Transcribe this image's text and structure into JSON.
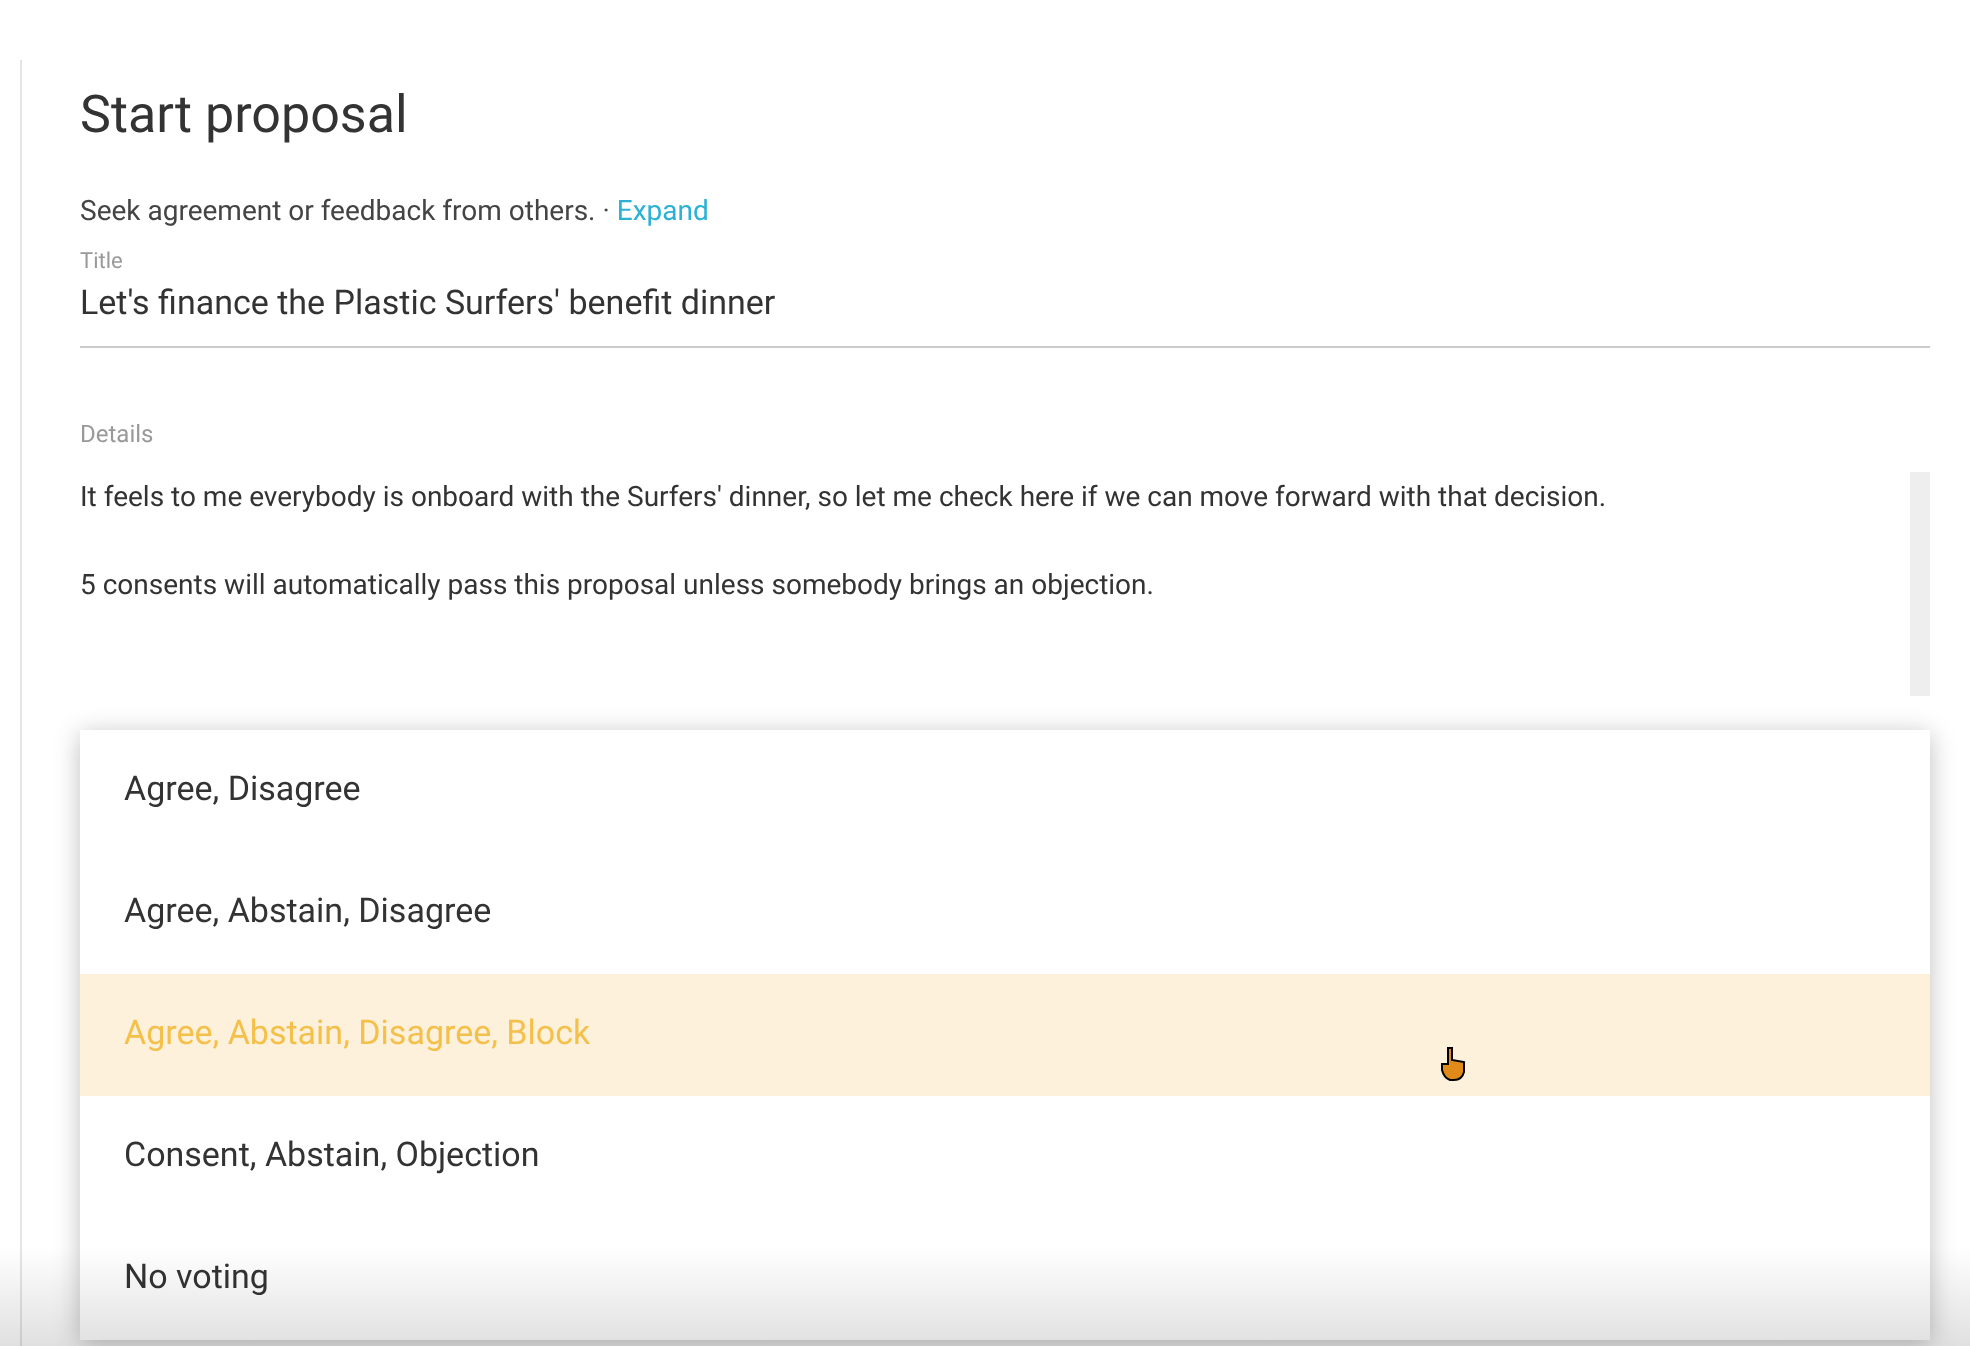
{
  "heading": "Start proposal",
  "subtitle": {
    "text": "Seek agreement or feedback from others. · ",
    "link": "Expand"
  },
  "title_field": {
    "label": "Title",
    "value": "Let's finance the Plastic Surfers' benefit dinner"
  },
  "details_field": {
    "label": "Details",
    "paragraphs": [
      "It feels to me everybody is onboard with the Surfers' dinner, so let me check here if we can move forward with that decision.",
      "5 consents will automatically pass this proposal unless somebody brings an objection."
    ]
  },
  "voting_menu": [
    {
      "label": "Agree, Disagree",
      "selected": false
    },
    {
      "label": "Agree, Abstain, Disagree",
      "selected": false
    },
    {
      "label": "Agree, Abstain, Disagree, Block",
      "selected": true
    },
    {
      "label": "Consent, Abstain, Objection",
      "selected": false
    },
    {
      "label": "No voting",
      "selected": false
    }
  ]
}
